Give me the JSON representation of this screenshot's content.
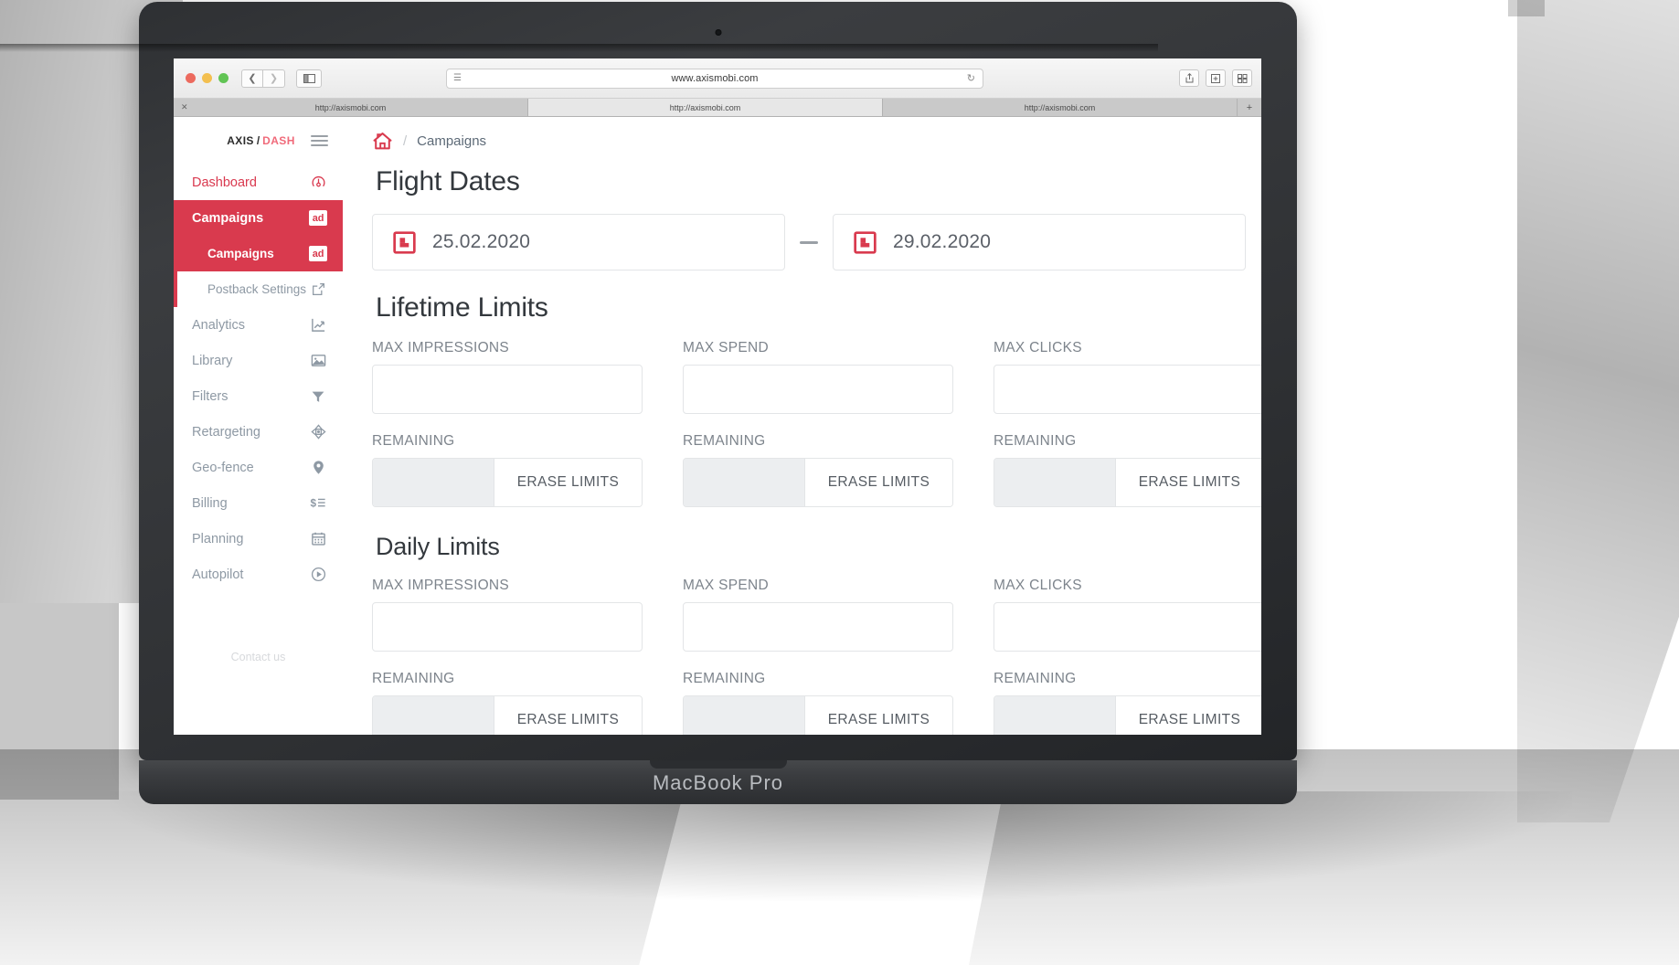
{
  "device": {
    "model_label": "MacBook Pro"
  },
  "browser": {
    "url": "www.axismobi.com",
    "back_icon": "chevron-left-icon",
    "forward_icon": "chevron-right-icon",
    "sidebar_toggle_icon": "sidebar-panel-icon",
    "reader_icon": "reader-view-icon",
    "reload_icon": "reload-icon",
    "share_icon": "share-icon",
    "newtab_icon": "new-tab-icon",
    "tabs_icon": "show-tabs-icon",
    "tabs": [
      {
        "title": "http://axismobi.com",
        "active": false,
        "close_icon": "close-icon"
      },
      {
        "title": "http://axismobi.com",
        "active": true,
        "close_icon": "close-icon"
      },
      {
        "title": "http://axismobi.com",
        "active": false,
        "close_icon": "close-icon"
      }
    ],
    "new_tab_label": "+"
  },
  "sidebar": {
    "brand": {
      "axis": "AXIS",
      "slash": "/",
      "dash": "DASH"
    },
    "menu_icon": "hamburger-menu-icon",
    "items": [
      {
        "label": "Dashboard",
        "icon": "speedometer-icon",
        "state": "accent",
        "badge": ""
      },
      {
        "label": "Campaigns",
        "icon": "ad-badge",
        "state": "active",
        "badge": "ad"
      },
      {
        "label": "Campaigns",
        "icon": "ad-badge",
        "state": "active-sub",
        "badge": "ad"
      },
      {
        "label": "Postback Settings",
        "icon": "external-link-icon",
        "state": "sub",
        "badge": ""
      },
      {
        "label": "Analytics",
        "icon": "line-chart-icon",
        "state": "normal",
        "badge": ""
      },
      {
        "label": "Library",
        "icon": "image-icon",
        "state": "normal",
        "badge": ""
      },
      {
        "label": "Filters",
        "icon": "funnel-icon",
        "state": "normal",
        "badge": ""
      },
      {
        "label": "Retargeting",
        "icon": "crosshair-icon",
        "state": "normal",
        "badge": ""
      },
      {
        "label": "Geo-fence",
        "icon": "map-pin-icon",
        "state": "normal",
        "badge": ""
      },
      {
        "label": "Billing",
        "icon": "dollar-list-icon",
        "state": "normal",
        "badge": ""
      },
      {
        "label": "Planning",
        "icon": "calendar-icon",
        "state": "normal",
        "badge": ""
      },
      {
        "label": "Autopilot",
        "icon": "play-circle-icon",
        "state": "normal",
        "badge": ""
      }
    ],
    "contact_us": "Contact us"
  },
  "breadcrumb": {
    "home_icon": "home-icon",
    "separator": "/",
    "current": "Campaigns"
  },
  "main": {
    "flight_dates": {
      "title": "Flight Dates",
      "start_date": "25.02.2020",
      "end_date": "29.02.2020",
      "calendar_icon": "calendar-picker-icon",
      "range_separator": "—"
    },
    "lifetime_limits": {
      "title": "Lifetime Limits",
      "columns": [
        {
          "label": "MAX IMPRESSIONS",
          "value": "",
          "remaining_label": "REMAINING",
          "remaining_value": "",
          "erase_label": "ERASE LIMITS"
        },
        {
          "label": "MAX SPEND",
          "value": "",
          "remaining_label": "REMAINING",
          "remaining_value": "",
          "erase_label": "ERASE LIMITS"
        },
        {
          "label": "MAX CLICKS",
          "value": "",
          "remaining_label": "REMAINING",
          "remaining_value": "",
          "erase_label": "ERASE LIMITS"
        }
      ]
    },
    "daily_limits": {
      "title": "Daily Limits",
      "columns": [
        {
          "label": "MAX IMPRESSIONS",
          "value": "",
          "remaining_label": "REMAINING",
          "remaining_value": "",
          "erase_label": "ERASE LIMITS"
        },
        {
          "label": "MAX SPEND",
          "value": "",
          "remaining_label": "REMAINING",
          "remaining_value": "",
          "erase_label": "ERASE LIMITS"
        },
        {
          "label": "MAX CLICKS",
          "value": "",
          "remaining_label": "REMAINING",
          "remaining_value": "",
          "erase_label": "ERASE LIMITS"
        }
      ]
    }
  },
  "colors": {
    "accent": "#d93a4e",
    "accent_light": "#f06a7a",
    "text_muted": "#8e99a4",
    "heading": "#33383d",
    "field_border": "#e3e5e7",
    "remaining_fill": "#eceef0"
  }
}
